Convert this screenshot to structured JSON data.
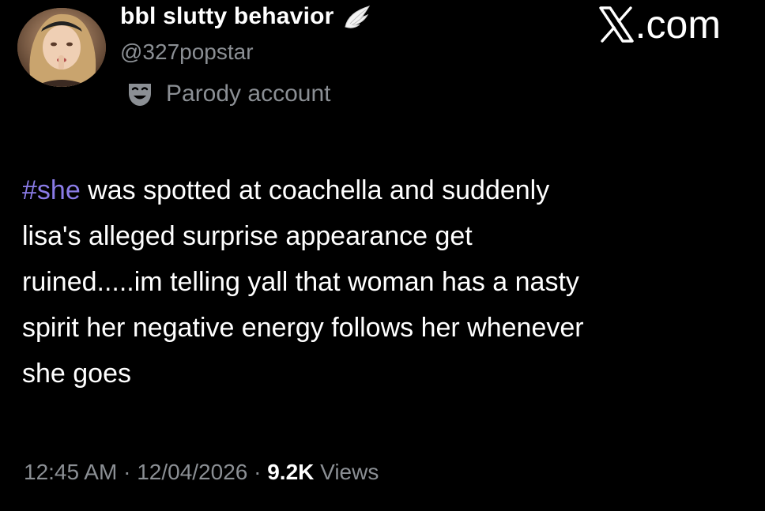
{
  "author": {
    "display_name": "bbl slutty behavior",
    "handle": "@327popstar",
    "label": "Parody account",
    "badge_icon": "angel-wing-icon",
    "label_icon": "theater-mask-icon"
  },
  "brand": {
    "text": ".com",
    "icon": "x-logo-icon"
  },
  "tweet": {
    "hashtag": "#she",
    "lines": [
      " was spotted at coachella and suddenly",
      "lisa's alleged surprise appearance get",
      "ruined.....im telling yall that woman has a nasty",
      "spirit her negative energy follows her whenever",
      "she goes"
    ]
  },
  "meta": {
    "time": "12:45 AM",
    "separator": " · ",
    "date": "12/04/2026",
    "views_count": "9.2K",
    "views_label": " Views"
  },
  "colors": {
    "background": "#000000",
    "text_primary": "#ffffff",
    "text_secondary": "#8b8f94",
    "hashtag": "#8a7be6"
  }
}
